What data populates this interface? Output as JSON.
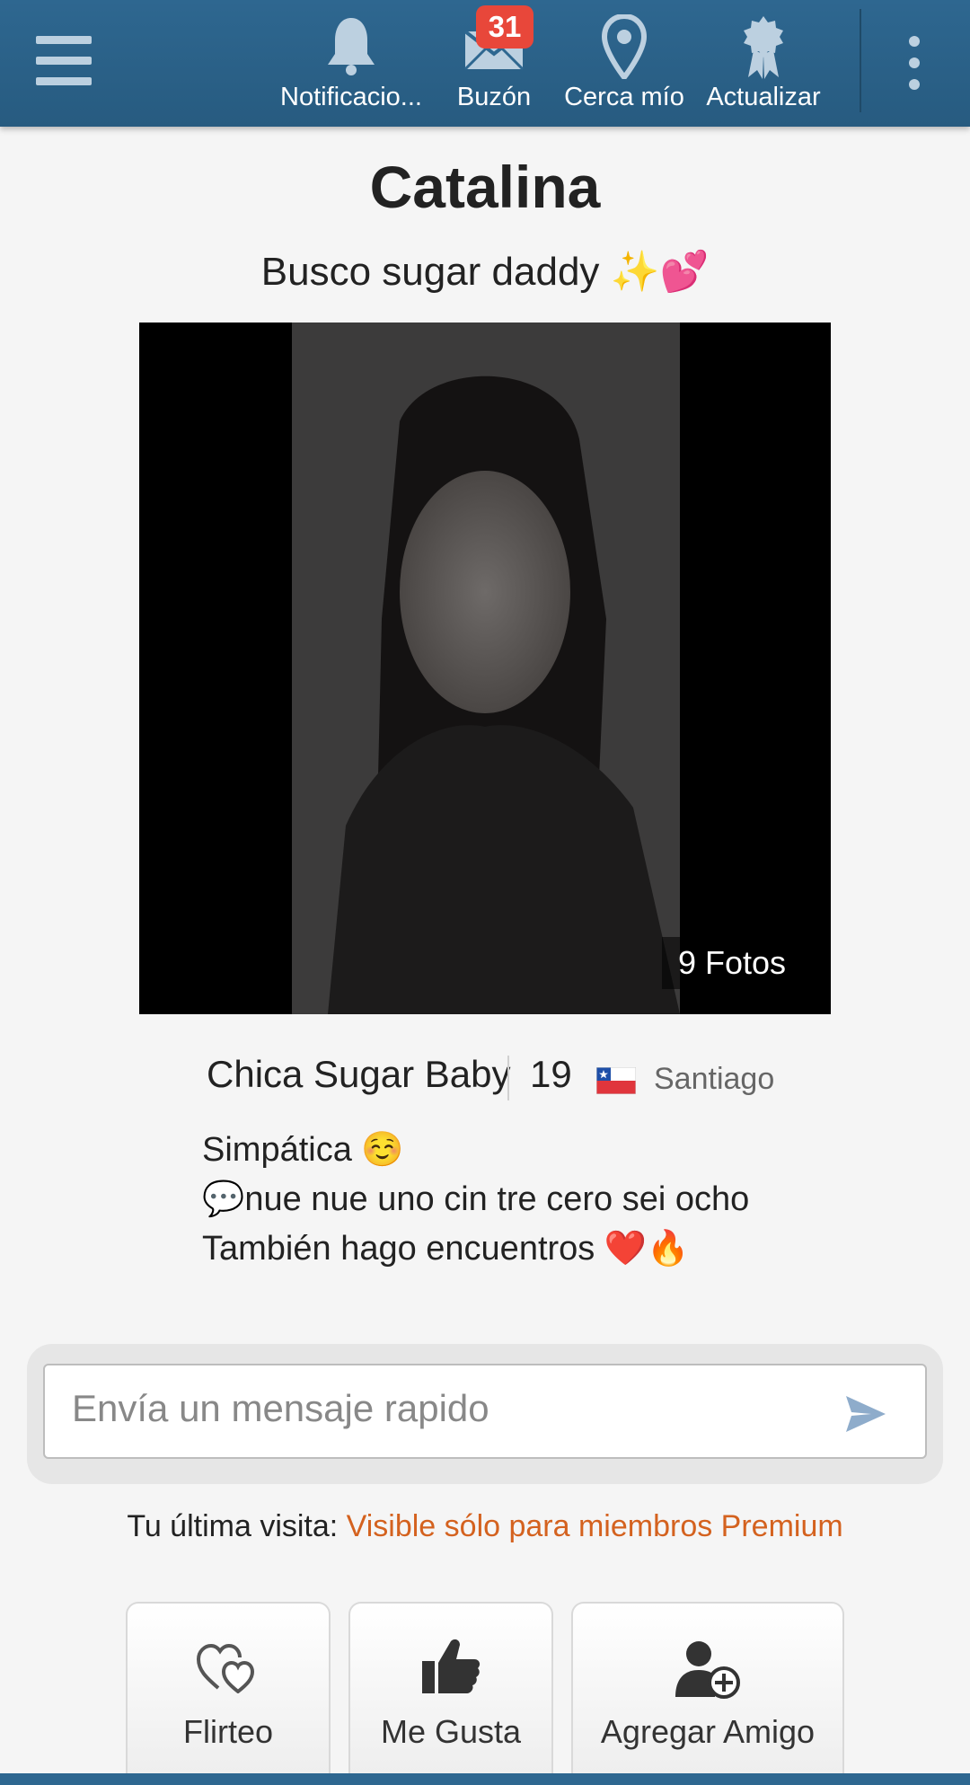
{
  "topbar": {
    "items": [
      {
        "label": "Notificacio...",
        "icon": "bell-icon"
      },
      {
        "label": "Buzón",
        "icon": "envelope-icon",
        "badge": "31"
      },
      {
        "label": "Cerca mío",
        "icon": "map-pin-icon"
      },
      {
        "label": "Actualizar",
        "icon": "award-ribbon-icon"
      }
    ],
    "accent": "#2e6790",
    "badge_color": "#e8473a"
  },
  "profile": {
    "name": "Catalina",
    "headline": "Busco sugar daddy ✨💕",
    "photo_count": "9 Fotos",
    "type": "Chica Sugar Baby",
    "age": "19",
    "country_flag": "flag-chile-icon",
    "city": "Santiago",
    "bio": [
      "Simpática ☺️",
      "💬nue nue uno cin tre cero sei ocho",
      "También hago encuentros ❤️🔥"
    ]
  },
  "message": {
    "placeholder": "Envía un mensaje rapido"
  },
  "visit": {
    "label": "Tu última visita: ",
    "value": "Visible sólo para miembros Premium",
    "value_color": "#d4621f"
  },
  "actions": [
    {
      "label": "Flirteo",
      "icon": "hearts-icon"
    },
    {
      "label": "Me Gusta",
      "icon": "thumbs-up-icon"
    },
    {
      "label": "Agregar Amigo",
      "icon": "add-friend-icon"
    }
  ]
}
